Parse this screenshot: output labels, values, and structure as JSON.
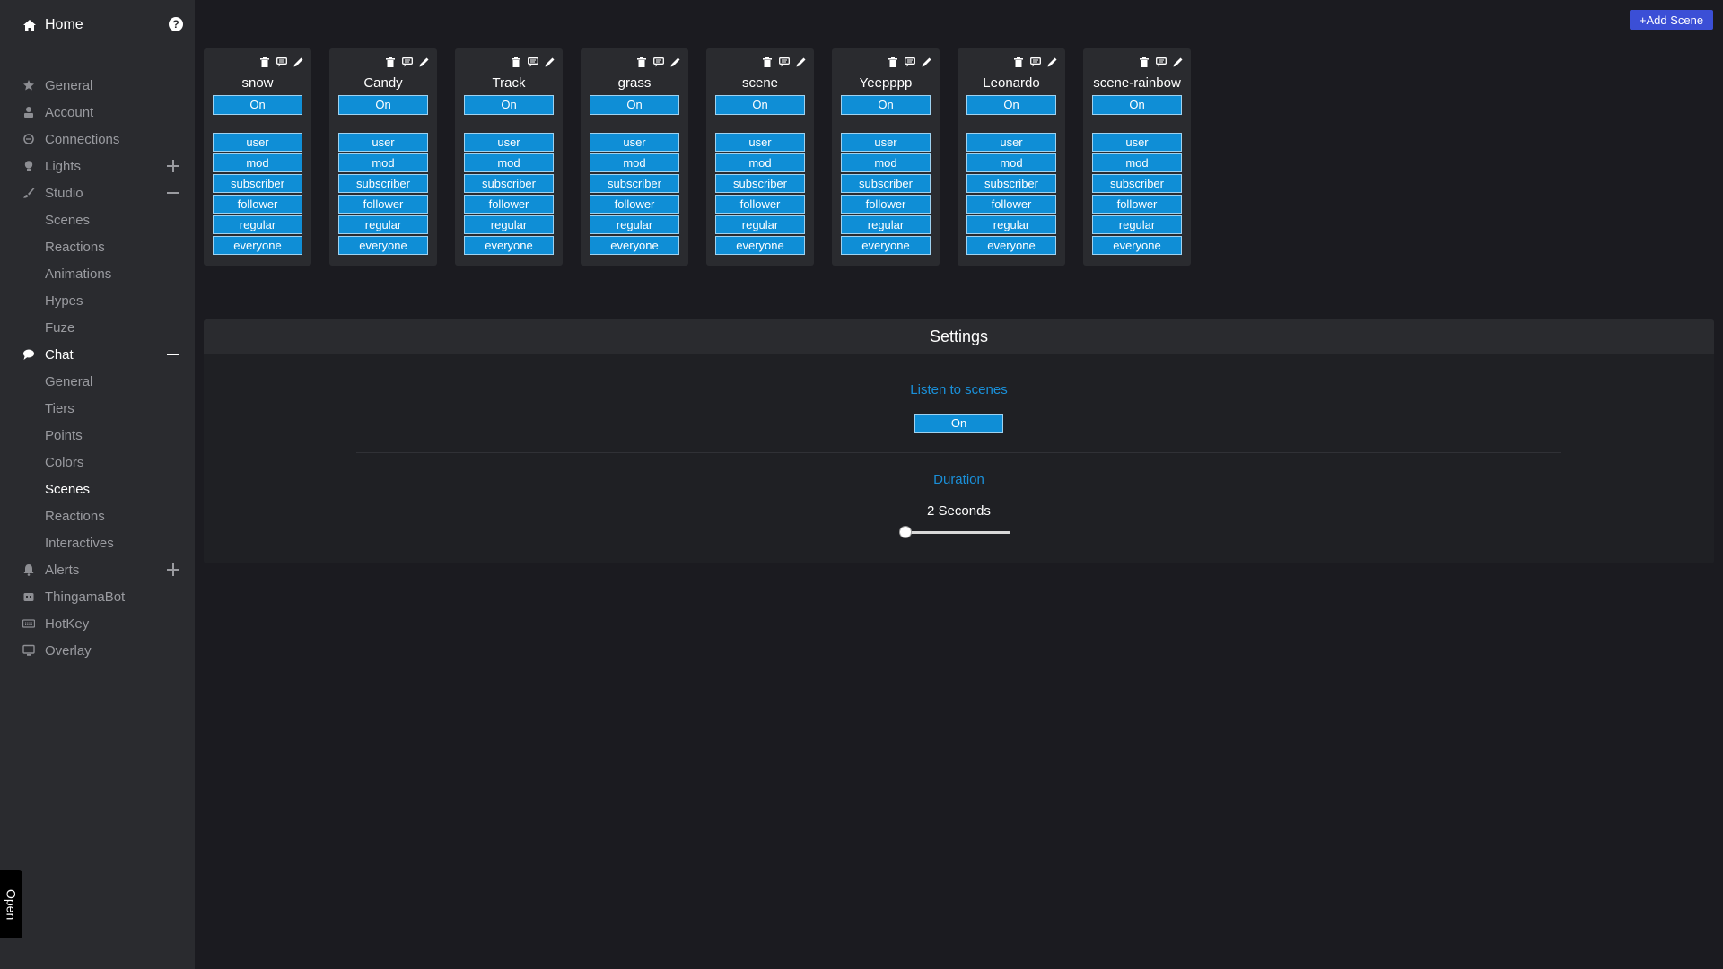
{
  "sidebar": {
    "home": "Home",
    "items": [
      {
        "label": "General",
        "icon": "star-icon",
        "active": false
      },
      {
        "label": "Account",
        "icon": "user-icon",
        "active": false
      },
      {
        "label": "Connections",
        "icon": "link-icon",
        "active": false
      },
      {
        "label": "Lights",
        "icon": "lightbulb-icon",
        "active": false,
        "toggle": "plus"
      },
      {
        "label": "Studio",
        "icon": "brush-icon",
        "active": false,
        "toggle": "minus",
        "children": [
          {
            "label": "Scenes",
            "active": false
          },
          {
            "label": "Reactions",
            "active": false
          },
          {
            "label": "Animations",
            "active": false
          },
          {
            "label": "Hypes",
            "active": false
          },
          {
            "label": "Fuze",
            "active": false
          }
        ]
      },
      {
        "label": "Chat",
        "icon": "chat-icon",
        "active": true,
        "toggle": "minus",
        "children": [
          {
            "label": "General",
            "active": false
          },
          {
            "label": "Tiers",
            "active": false
          },
          {
            "label": "Points",
            "active": false
          },
          {
            "label": "Colors",
            "active": false
          },
          {
            "label": "Scenes",
            "active": true
          },
          {
            "label": "Reactions",
            "active": false
          },
          {
            "label": "Interactives",
            "active": false
          }
        ]
      },
      {
        "label": "Alerts",
        "icon": "bell-icon",
        "active": false,
        "toggle": "plus"
      },
      {
        "label": "ThingamaBot",
        "icon": "robot-icon",
        "active": false
      },
      {
        "label": "HotKey",
        "icon": "keyboard-icon",
        "active": false
      },
      {
        "label": "Overlay",
        "icon": "monitor-icon",
        "active": false
      }
    ],
    "open_tab": "Open"
  },
  "add_scene": "+Add Scene",
  "scenes": [
    {
      "name": "snow",
      "state": "On"
    },
    {
      "name": "Candy",
      "state": "On"
    },
    {
      "name": "Track",
      "state": "On"
    },
    {
      "name": "grass",
      "state": "On"
    },
    {
      "name": "scene",
      "state": "On"
    },
    {
      "name": "Yeepppp",
      "state": "On"
    },
    {
      "name": "Leonardo",
      "state": "On"
    },
    {
      "name": "scene-rainbow",
      "state": "On"
    }
  ],
  "roles": [
    "user",
    "mod",
    "subscriber",
    "follower",
    "regular",
    "everyone"
  ],
  "settings": {
    "title": "Settings",
    "listen_label": "Listen to scenes",
    "listen_value": "On",
    "duration_label": "Duration",
    "duration_value": "2 Seconds",
    "duration_fraction": 0.0
  },
  "colors": {
    "accent": "#0f8ed6",
    "add_button": "#3b4fd6",
    "label_blue": "#1a90d9"
  }
}
